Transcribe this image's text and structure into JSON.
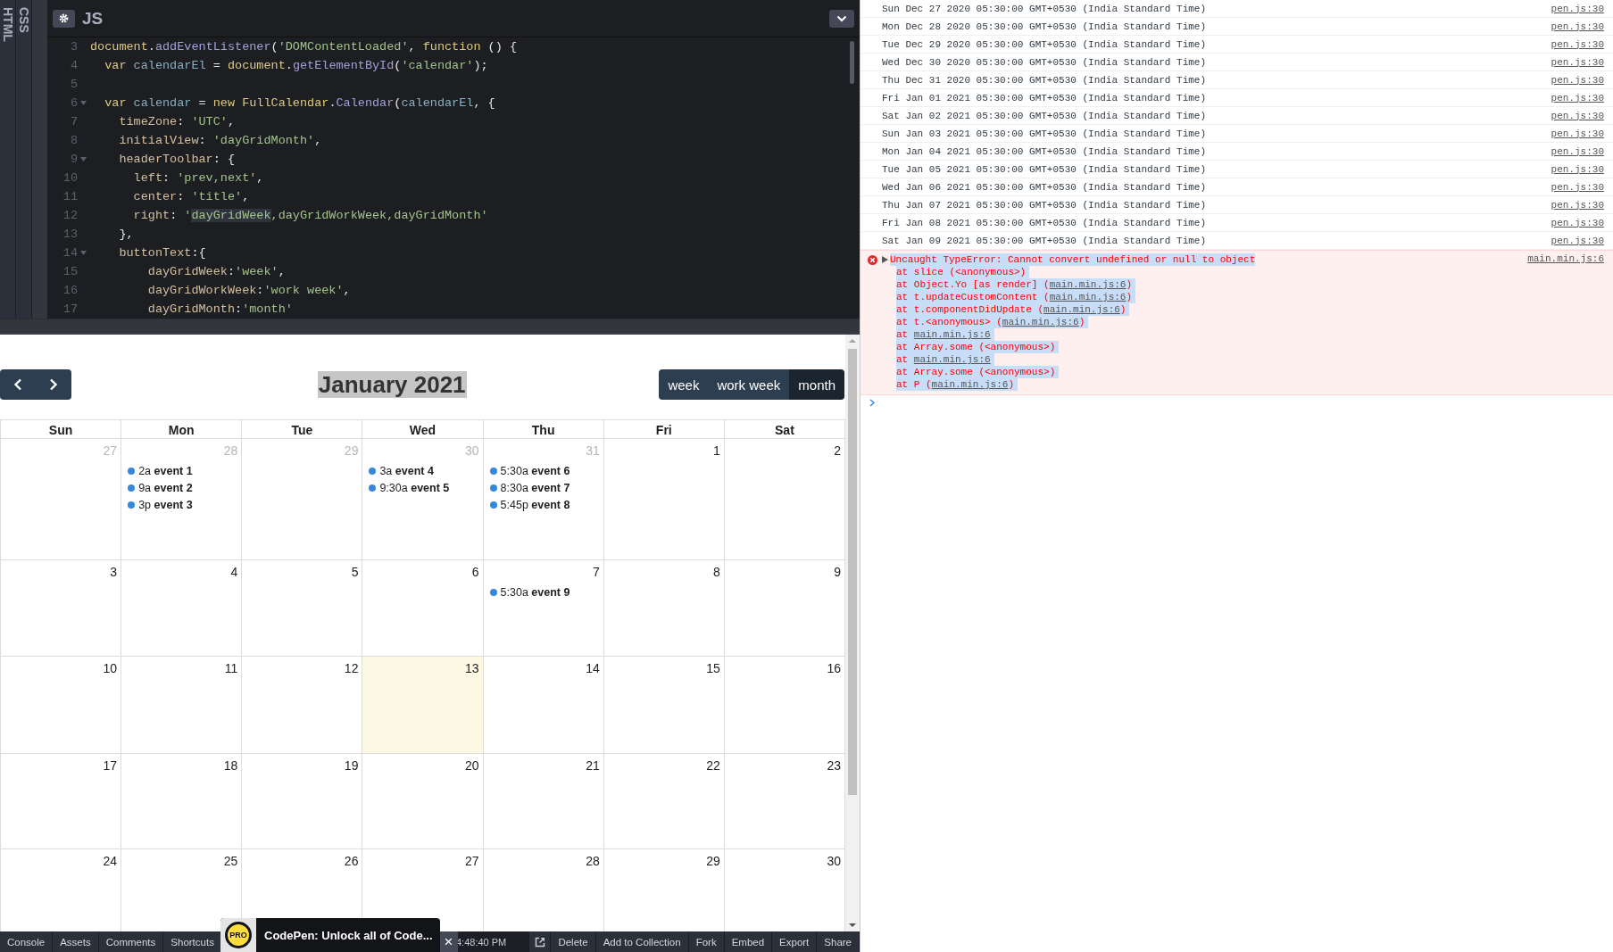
{
  "editor": {
    "side_tabs": [
      "HTML",
      "CSS"
    ],
    "title": "JS",
    "lines": [
      {
        "number": "3",
        "fold": false,
        "tokens": [
          {
            "text": "document",
            "kind": "kw"
          },
          {
            "text": ".",
            "kind": "p"
          },
          {
            "text": "addEventListener",
            "kind": "method"
          },
          {
            "text": "(",
            "kind": "p"
          },
          {
            "text": "'DOMContentLoaded'",
            "kind": "str"
          },
          {
            "text": ", ",
            "kind": "p"
          },
          {
            "text": "function",
            "kind": "kw"
          },
          {
            "text": " () {",
            "kind": "p"
          }
        ]
      },
      {
        "number": "4",
        "fold": false,
        "tokens": [
          {
            "text": "  var",
            "kind": "kw"
          },
          {
            "text": " calendarEl",
            "kind": "name"
          },
          {
            "text": " = ",
            "kind": "p"
          },
          {
            "text": "document",
            "kind": "kw"
          },
          {
            "text": ".",
            "kind": "p"
          },
          {
            "text": "getElementById",
            "kind": "method"
          },
          {
            "text": "(",
            "kind": "p"
          },
          {
            "text": "'calendar'",
            "kind": "str"
          },
          {
            "text": ");",
            "kind": "p"
          }
        ]
      },
      {
        "number": "5",
        "fold": false
      },
      {
        "number": "6",
        "fold": true,
        "tokens": [
          {
            "text": "  var",
            "kind": "kw"
          },
          {
            "text": " calendar",
            "kind": "name"
          },
          {
            "text": " = ",
            "kind": "p"
          },
          {
            "text": "new FullCalendar",
            "kind": "kw"
          },
          {
            "text": ".",
            "kind": "p"
          },
          {
            "text": "Calendar",
            "kind": "method"
          },
          {
            "text": "(",
            "kind": "p"
          },
          {
            "text": "calendarEl",
            "kind": "name"
          },
          {
            "text": ", {",
            "kind": "p"
          }
        ]
      },
      {
        "number": "7",
        "fold": false,
        "tokens": [
          {
            "text": "    timeZone",
            "kind": "prop"
          },
          {
            "text": ": ",
            "kind": "p"
          },
          {
            "text": "'UTC'",
            "kind": "str"
          },
          {
            "text": ",",
            "kind": "p"
          }
        ]
      },
      {
        "number": "8",
        "fold": false,
        "tokens": [
          {
            "text": "    initialView",
            "kind": "prop"
          },
          {
            "text": ": ",
            "kind": "p"
          },
          {
            "text": "'dayGridMonth'",
            "kind": "str"
          },
          {
            "text": ",",
            "kind": "p"
          }
        ]
      },
      {
        "number": "9",
        "fold": true,
        "tokens": [
          {
            "text": "    headerToolbar",
            "kind": "prop"
          },
          {
            "text": ": {",
            "kind": "p"
          }
        ]
      },
      {
        "number": "10",
        "fold": false,
        "tokens": [
          {
            "text": "      left",
            "kind": "prop"
          },
          {
            "text": ": ",
            "kind": "p"
          },
          {
            "text": "'prev,next'",
            "kind": "str"
          },
          {
            "text": ",",
            "kind": "p"
          }
        ]
      },
      {
        "number": "11",
        "fold": false,
        "tokens": [
          {
            "text": "      center",
            "kind": "prop"
          },
          {
            "text": ": ",
            "kind": "p"
          },
          {
            "text": "'title'",
            "kind": "str"
          },
          {
            "text": ",",
            "kind": "p"
          }
        ]
      },
      {
        "number": "12",
        "fold": false,
        "tokens": [
          {
            "text": "      right",
            "kind": "prop"
          },
          {
            "text": ": ",
            "kind": "p"
          },
          {
            "text": "'",
            "kind": "str"
          },
          {
            "text": "dayGridWeek",
            "kind": "match"
          },
          {
            "text": ",dayGridWorkWeek,dayGridMonth'",
            "kind": "str"
          }
        ]
      },
      {
        "number": "13",
        "fold": false,
        "tokens": [
          {
            "text": "    },",
            "kind": "p"
          }
        ]
      },
      {
        "number": "14",
        "fold": true,
        "tokens": [
          {
            "text": "    buttonText",
            "kind": "prop"
          },
          {
            "text": ":{",
            "kind": "p"
          }
        ]
      },
      {
        "number": "15",
        "fold": false,
        "tokens": [
          {
            "text": "        dayGridWeek",
            "kind": "prop"
          },
          {
            "text": ":",
            "kind": "p"
          },
          {
            "text": "'week'",
            "kind": "str"
          },
          {
            "text": ",",
            "kind": "p"
          }
        ]
      },
      {
        "number": "16",
        "fold": false,
        "tokens": [
          {
            "text": "        dayGridWorkWeek",
            "kind": "prop"
          },
          {
            "text": ":",
            "kind": "p"
          },
          {
            "text": "'work week'",
            "kind": "str"
          },
          {
            "text": ",",
            "kind": "p"
          }
        ]
      },
      {
        "number": "17",
        "fold": false,
        "tokens": [
          {
            "text": "        dayGridMonth",
            "kind": "prop"
          },
          {
            "text": ":",
            "kind": "p"
          },
          {
            "text": "'month'",
            "kind": "str"
          }
        ]
      }
    ]
  },
  "calendar": {
    "title": "January 2021",
    "view_buttons": [
      {
        "label": "week",
        "selected": false
      },
      {
        "label": "work week",
        "selected": false
      },
      {
        "label": "month",
        "selected": true
      }
    ],
    "weekdays": [
      "Sun",
      "Mon",
      "Tue",
      "Wed",
      "Thu",
      "Fri",
      "Sat"
    ],
    "weeks": [
      [
        {
          "day": "27",
          "other_month": true,
          "today": false
        },
        {
          "day": "28",
          "other_month": true,
          "today": false,
          "events": [
            "2a **event 1**",
            "9a **event 2**",
            "3p **event 3**"
          ]
        },
        {
          "day": "29",
          "other_month": true,
          "today": false
        },
        {
          "day": "30",
          "other_month": true,
          "today": false,
          "events": [
            "3a **event 4**",
            "9:30a **event 5**"
          ]
        },
        {
          "day": "31",
          "other_month": true,
          "today": false,
          "events": [
            "5:30a **event 6**",
            "8:30a **event 7**",
            "5:45p **event 8**"
          ]
        },
        {
          "day": "1",
          "other_month": false,
          "today": false
        },
        {
          "day": "2",
          "other_month": false,
          "today": false
        }
      ],
      [
        {
          "day": "3",
          "other_month": false,
          "today": false
        },
        {
          "day": "4",
          "other_month": false,
          "today": false
        },
        {
          "day": "5",
          "other_month": false,
          "today": false
        },
        {
          "day": "6",
          "other_month": false,
          "today": false
        },
        {
          "day": "7",
          "other_month": false,
          "today": false,
          "events": [
            "5:30a **event 9**"
          ]
        },
        {
          "day": "8",
          "other_month": false,
          "today": false
        },
        {
          "day": "9",
          "other_month": false,
          "today": false
        }
      ],
      [
        {
          "day": "10",
          "other_month": false,
          "today": false
        },
        {
          "day": "11",
          "other_month": false,
          "today": false
        },
        {
          "day": "12",
          "other_month": false,
          "today": false
        },
        {
          "day": "13",
          "other_month": false,
          "today": true
        },
        {
          "day": "14",
          "other_month": false,
          "today": false
        },
        {
          "day": "15",
          "other_month": false,
          "today": false
        },
        {
          "day": "16",
          "other_month": false,
          "today": false
        }
      ],
      [
        {
          "day": "17",
          "other_month": false,
          "today": false
        },
        {
          "day": "18",
          "other_month": false,
          "today": false
        },
        {
          "day": "19",
          "other_month": false,
          "today": false
        },
        {
          "day": "20",
          "other_month": false,
          "today": false
        },
        {
          "day": "21",
          "other_month": false,
          "today": false
        },
        {
          "day": "22",
          "other_month": false,
          "today": false
        },
        {
          "day": "23",
          "other_month": false,
          "today": false
        }
      ],
      [
        {
          "day": "24",
          "other_month": false,
          "today": false
        },
        {
          "day": "25",
          "other_month": false,
          "today": false
        },
        {
          "day": "26",
          "other_month": false,
          "today": false
        },
        {
          "day": "27",
          "other_month": false,
          "today": false
        },
        {
          "day": "28",
          "other_month": false,
          "today": false
        },
        {
          "day": "29",
          "other_month": false,
          "today": false
        },
        {
          "day": "30",
          "other_month": false,
          "today": false
        }
      ]
    ]
  },
  "footer": {
    "left_items": [
      "Console",
      "Assets",
      "Comments",
      "Shortcuts"
    ],
    "time": "4:48:40 PM",
    "right_items": [
      "Delete",
      "Add to Collection",
      "Fork",
      "Embed",
      "Export",
      "Share"
    ],
    "promo": {
      "badge": "PRO",
      "text": "CodePen: Unlock all of Code...",
      "close": "×"
    }
  },
  "console": {
    "logs": [
      {
        "message": "Sun Dec 27 2020 05:30:00 GMT+0530 (India Standard Time)",
        "source": "pen.js:30"
      },
      {
        "message": "Mon Dec 28 2020 05:30:00 GMT+0530 (India Standard Time)",
        "source": "pen.js:30"
      },
      {
        "message": "Tue Dec 29 2020 05:30:00 GMT+0530 (India Standard Time)",
        "source": "pen.js:30"
      },
      {
        "message": "Wed Dec 30 2020 05:30:00 GMT+0530 (India Standard Time)",
        "source": "pen.js:30"
      },
      {
        "message": "Thu Dec 31 2020 05:30:00 GMT+0530 (India Standard Time)",
        "source": "pen.js:30"
      },
      {
        "message": "Fri Jan 01 2021 05:30:00 GMT+0530 (India Standard Time)",
        "source": "pen.js:30"
      },
      {
        "message": "Sat Jan 02 2021 05:30:00 GMT+0530 (India Standard Time)",
        "source": "pen.js:30"
      },
      {
        "message": "Sun Jan 03 2021 05:30:00 GMT+0530 (India Standard Time)",
        "source": "pen.js:30"
      },
      {
        "message": "Mon Jan 04 2021 05:30:00 GMT+0530 (India Standard Time)",
        "source": "pen.js:30"
      },
      {
        "message": "Tue Jan 05 2021 05:30:00 GMT+0530 (India Standard Time)",
        "source": "pen.js:30"
      },
      {
        "message": "Wed Jan 06 2021 05:30:00 GMT+0530 (India Standard Time)",
        "source": "pen.js:30"
      },
      {
        "message": "Thu Jan 07 2021 05:30:00 GMT+0530 (India Standard Time)",
        "source": "pen.js:30"
      },
      {
        "message": "Fri Jan 08 2021 05:30:00 GMT+0530 (India Standard Time)",
        "source": "pen.js:30"
      },
      {
        "message": "Sat Jan 09 2021 05:30:00 GMT+0530 (India Standard Time)",
        "source": "pen.js:30"
      }
    ],
    "error": {
      "message": "Uncaught TypeError: Cannot convert undefined or null to object",
      "source": "main.min.js:6",
      "stack": [
        {
          "prefix": "at slice (<anonymous>)"
        },
        {
          "prefix": "at Object.Yo [as render] (",
          "link": "main.min.js:6",
          "suffix": ")"
        },
        {
          "prefix": "at t.updateCustomContent (",
          "link": "main.min.js:6",
          "suffix": ")"
        },
        {
          "prefix": "at t.componentDidUpdate (",
          "link": "main.min.js:6",
          "suffix": ")"
        },
        {
          "prefix": "at t.<anonymous> (",
          "link": "main.min.js:6",
          "suffix": ")"
        },
        {
          "prefix": "at ",
          "link": "main.min.js:6"
        },
        {
          "prefix": "at Array.some (<anonymous>)"
        },
        {
          "prefix": "at ",
          "link": "main.min.js:6"
        },
        {
          "prefix": "at Array.some (<anonymous>)"
        },
        {
          "prefix": "at P (",
          "link": "main.min.js:6",
          "suffix": ")"
        }
      ]
    }
  }
}
